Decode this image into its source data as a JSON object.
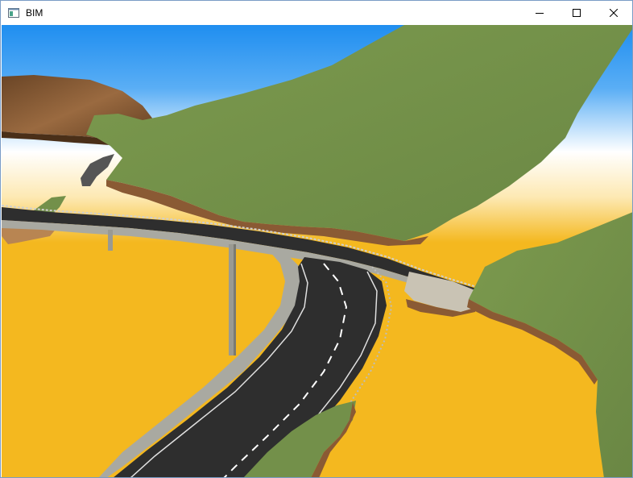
{
  "window": {
    "title": "BIM",
    "icon": "application-window-icon",
    "controls": [
      "minimize-icon",
      "maximize-icon",
      "close-icon"
    ]
  },
  "scene": {
    "description_icons": [
      "terrain",
      "road",
      "bridge",
      "piers"
    ],
    "colors": {
      "sky_top": "#1f8ef0",
      "sky_mid": "#ffffff",
      "ground": "#f4b81f",
      "grass": "#73904a",
      "soil": "#8a5a34",
      "asphalt": "#2e2e2e",
      "concrete": "#a9a9a1"
    }
  }
}
